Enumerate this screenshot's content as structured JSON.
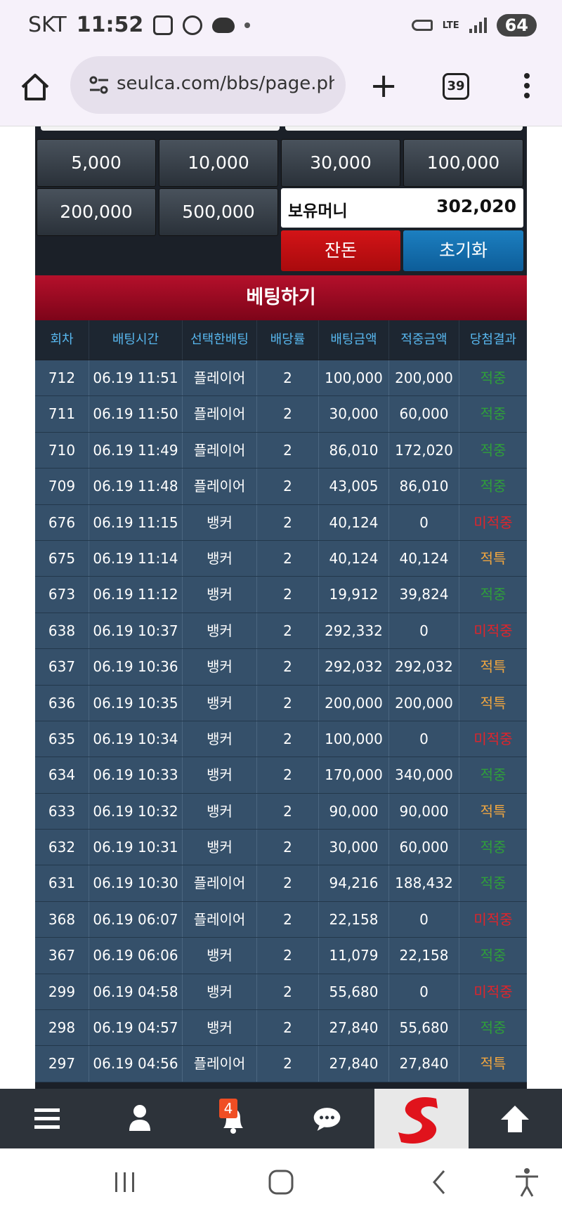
{
  "status_bar": {
    "carrier": "SKT",
    "time": "11:52",
    "network": "LTE",
    "battery": "64"
  },
  "browser": {
    "url": "seulca.com/bbs/page.php",
    "tab_count": "39"
  },
  "amount_buttons": [
    "5,000",
    "10,000",
    "30,000",
    "100,000",
    "200,000",
    "500,000"
  ],
  "money": {
    "label": "보유머니",
    "value": "302,020"
  },
  "buttons": {
    "all_in": "잔돈",
    "reset": "초기화"
  },
  "bet_section": {
    "title": "베팅하기",
    "columns": [
      "회차",
      "배팅시간",
      "선택한배팅",
      "배당률",
      "배팅금액",
      "적중금액",
      "당첨결과"
    ],
    "rows": [
      {
        "round": "712",
        "time": "06.19 11:51",
        "pick": "플레이어",
        "odds": "2",
        "bet": "100,000",
        "win": "200,000",
        "result": "적중",
        "status": "win"
      },
      {
        "round": "711",
        "time": "06.19 11:50",
        "pick": "플레이어",
        "odds": "2",
        "bet": "30,000",
        "win": "60,000",
        "result": "적중",
        "status": "win"
      },
      {
        "round": "710",
        "time": "06.19 11:49",
        "pick": "플레이어",
        "odds": "2",
        "bet": "86,010",
        "win": "172,020",
        "result": "적중",
        "status": "win"
      },
      {
        "round": "709",
        "time": "06.19 11:48",
        "pick": "플레이어",
        "odds": "2",
        "bet": "43,005",
        "win": "86,010",
        "result": "적중",
        "status": "win"
      },
      {
        "round": "676",
        "time": "06.19 11:15",
        "pick": "뱅커",
        "odds": "2",
        "bet": "40,124",
        "win": "0",
        "result": "미적중",
        "status": "lose"
      },
      {
        "round": "675",
        "time": "06.19 11:14",
        "pick": "뱅커",
        "odds": "2",
        "bet": "40,124",
        "win": "40,124",
        "result": "적특",
        "status": "push"
      },
      {
        "round": "673",
        "time": "06.19 11:12",
        "pick": "뱅커",
        "odds": "2",
        "bet": "19,912",
        "win": "39,824",
        "result": "적중",
        "status": "win"
      },
      {
        "round": "638",
        "time": "06.19 10:37",
        "pick": "뱅커",
        "odds": "2",
        "bet": "292,332",
        "win": "0",
        "result": "미적중",
        "status": "lose"
      },
      {
        "round": "637",
        "time": "06.19 10:36",
        "pick": "뱅커",
        "odds": "2",
        "bet": "292,032",
        "win": "292,032",
        "result": "적특",
        "status": "push"
      },
      {
        "round": "636",
        "time": "06.19 10:35",
        "pick": "뱅커",
        "odds": "2",
        "bet": "200,000",
        "win": "200,000",
        "result": "적특",
        "status": "push"
      },
      {
        "round": "635",
        "time": "06.19 10:34",
        "pick": "뱅커",
        "odds": "2",
        "bet": "100,000",
        "win": "0",
        "result": "미적중",
        "status": "lose"
      },
      {
        "round": "634",
        "time": "06.19 10:33",
        "pick": "뱅커",
        "odds": "2",
        "bet": "170,000",
        "win": "340,000",
        "result": "적중",
        "status": "win"
      },
      {
        "round": "633",
        "time": "06.19 10:32",
        "pick": "뱅커",
        "odds": "2",
        "bet": "90,000",
        "win": "90,000",
        "result": "적특",
        "status": "push"
      },
      {
        "round": "632",
        "time": "06.19 10:31",
        "pick": "뱅커",
        "odds": "2",
        "bet": "30,000",
        "win": "60,000",
        "result": "적중",
        "status": "win"
      },
      {
        "round": "631",
        "time": "06.19 10:30",
        "pick": "플레이어",
        "odds": "2",
        "bet": "94,216",
        "win": "188,432",
        "result": "적중",
        "status": "win"
      },
      {
        "round": "368",
        "time": "06.19 06:07",
        "pick": "플레이어",
        "odds": "2",
        "bet": "22,158",
        "win": "0",
        "result": "미적중",
        "status": "lose"
      },
      {
        "round": "367",
        "time": "06.19 06:06",
        "pick": "뱅커",
        "odds": "2",
        "bet": "11,079",
        "win": "22,158",
        "result": "적중",
        "status": "win"
      },
      {
        "round": "299",
        "time": "06.19 04:58",
        "pick": "뱅커",
        "odds": "2",
        "bet": "55,680",
        "win": "0",
        "result": "미적중",
        "status": "lose"
      },
      {
        "round": "298",
        "time": "06.19 04:57",
        "pick": "뱅커",
        "odds": "2",
        "bet": "27,840",
        "win": "55,680",
        "result": "적중",
        "status": "win"
      },
      {
        "round": "297",
        "time": "06.19 04:56",
        "pick": "플레이어",
        "odds": "2",
        "bet": "27,840",
        "win": "27,840",
        "result": "적특",
        "status": "push"
      }
    ]
  },
  "bottom_nav": {
    "items": [
      "menu-icon",
      "user-icon",
      "bell-icon",
      "chat-icon",
      "site-logo",
      "arrow-up-icon"
    ],
    "notification_count": "4"
  },
  "colors": {
    "win": "#2f9f3a",
    "lose": "#e0242b",
    "push": "#f0a640",
    "header_red": "#b5102b",
    "reset_blue": "#1c7fc0"
  }
}
